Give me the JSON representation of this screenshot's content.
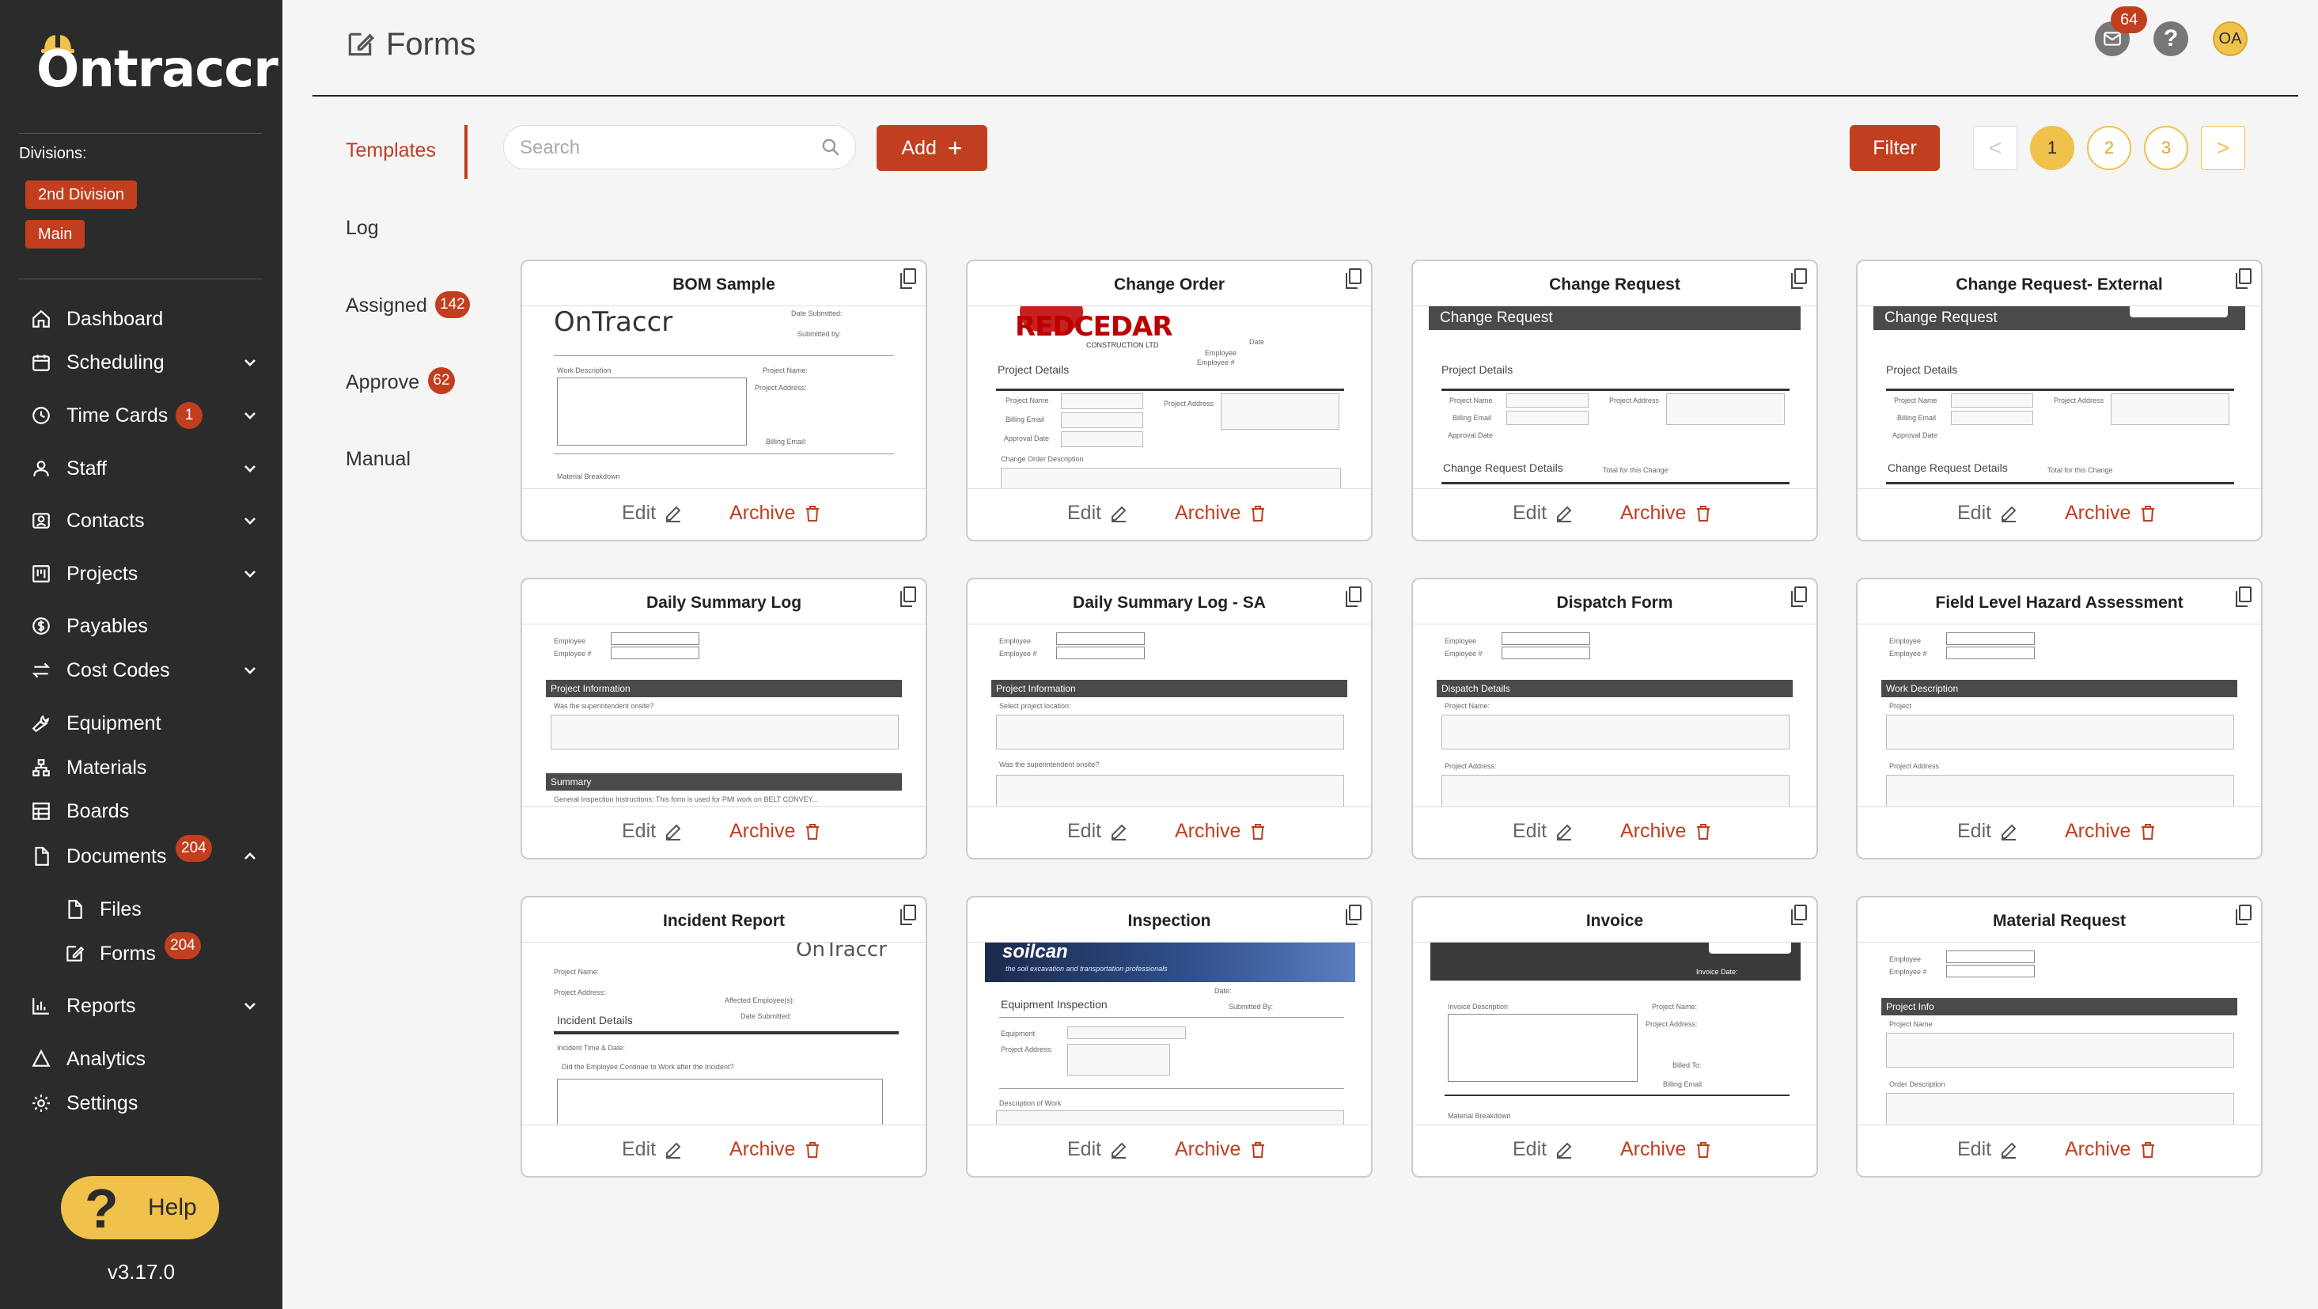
{
  "app": {
    "logo_text": "Ontraccr",
    "divisions_label": "Divisions:",
    "divisions": [
      "2nd Division",
      "Main"
    ],
    "version": "v3.17.0",
    "help_label": "Help"
  },
  "nav": {
    "dashboard": {
      "label": "Dashboard"
    },
    "scheduling": {
      "label": "Scheduling"
    },
    "time_cards": {
      "label": "Time Cards",
      "badge": "1"
    },
    "staff": {
      "label": "Staff"
    },
    "contacts": {
      "label": "Contacts"
    },
    "projects": {
      "label": "Projects"
    },
    "payables": {
      "label": "Payables"
    },
    "cost_codes": {
      "label": "Cost Codes"
    },
    "equipment": {
      "label": "Equipment"
    },
    "materials": {
      "label": "Materials"
    },
    "boards": {
      "label": "Boards"
    },
    "documents": {
      "label": "Documents",
      "badge": "204"
    },
    "files": {
      "label": "Files"
    },
    "forms": {
      "label": "Forms",
      "badge": "204"
    },
    "reports": {
      "label": "Reports"
    },
    "analytics": {
      "label": "Analytics"
    },
    "settings": {
      "label": "Settings"
    }
  },
  "header": {
    "title": "Forms",
    "mail_badge": "64",
    "help_glyph": "?",
    "avatar_initials": "OA"
  },
  "subnav": {
    "templates": "Templates",
    "log": "Log",
    "assigned": "Assigned",
    "assigned_badge": "142",
    "approve": "Approve",
    "approve_badge": "62",
    "manual": "Manual"
  },
  "toolbar": {
    "search_placeholder": "Search",
    "add_label": "Add",
    "add_glyph": "+",
    "filter_label": "Filter",
    "prev_glyph": "<",
    "next_glyph": ">",
    "pages": [
      "1",
      "2",
      "3"
    ],
    "current_page": "1"
  },
  "card_actions": {
    "edit": "Edit",
    "archive": "Archive"
  },
  "cards": [
    {
      "title": "BOM Sample"
    },
    {
      "title": "Change Order"
    },
    {
      "title": "Change Request"
    },
    {
      "title": "Change Request- External"
    },
    {
      "title": "Daily Summary Log"
    },
    {
      "title": "Daily Summary Log - SA"
    },
    {
      "title": "Dispatch Form"
    },
    {
      "title": "Field Level Hazard Assessment"
    },
    {
      "title": "Incident Report"
    },
    {
      "title": "Inspection"
    },
    {
      "title": "Invoice"
    },
    {
      "title": "Material Request"
    }
  ],
  "previews": {
    "bom": {
      "logo": "OnTraccr",
      "date_submitted": "Date Submitted:",
      "submitted_by": "Submitted by:",
      "work_description": "Work Description",
      "project_name": "Project Name:",
      "project_address": "Project Address:",
      "billing_email": "Billing Email:",
      "material_breakdown": "Material Breakdown"
    },
    "change_order": {
      "logo": "REDCEDAR",
      "logo_sub": "CONSTRUCTION LTD",
      "project_details": "Project Details",
      "project_name": "Project Name",
      "billing_email": "Billing Email",
      "approval_date": "Approval Date",
      "project_address": "Project Address",
      "description": "Change Order Description",
      "date": "Date",
      "employee": "Employee",
      "employee_num": "Employee #"
    },
    "change_request": {
      "header": "Change Request",
      "project_details": "Project Details",
      "project_name": "Project Name",
      "project_address": "Project Address",
      "billing_email": "Billing Email",
      "approval_date": "Approval Date",
      "cr_details": "Change Request Details",
      "total": "Total for this Change"
    },
    "daily_summary": {
      "employee": "Employee",
      "employee_num": "Employee #",
      "project_information": "Project Information",
      "question": "Was the superintendent onsite?",
      "summary": "Summary",
      "instructions": "General Inspection Instructions: This form is used for PMI work on BELT CONVEY..."
    },
    "daily_summary_sa": {
      "employee": "Employee",
      "employee_num": "Employee #",
      "project_information": "Project Information",
      "select": "Select project location:",
      "question": "Was the superintendent onsite?"
    },
    "dispatch": {
      "employee": "Employee",
      "employee_num": "Employee #",
      "dispatch_details": "Dispatch Details",
      "project_name": "Project Name:",
      "project_address": "Project Address:"
    },
    "hazard": {
      "employee": "Employee",
      "employee_num": "Employee #",
      "work_description": "Work Description",
      "project": "Project",
      "project_address": "Project Address"
    },
    "incident": {
      "logo": "OnTraccr",
      "project_name": "Project Name:",
      "project_address": "Project Address:",
      "affected": "Affected Employee(s):",
      "date_submitted": "Date Submitted:",
      "incident_details": "Incident Details",
      "incident_time": "Incident Time & Date:",
      "continue": "Did the Employee Continue to Work after the Incident?"
    },
    "inspection": {
      "banner": "soilcan",
      "banner_sub": "the soil excavation and transportation professionals",
      "date": "Date:",
      "equipment_inspection": "Equipment Inspection",
      "submitted_by": "Submitted By:",
      "equipment": "Equipment",
      "project_address": "Project Address:",
      "description": "Description of Work"
    },
    "invoice": {
      "invoice_date": "Invoice Date:",
      "invoice_description": "Invoice Description",
      "project_name": "Project Name:",
      "project_address": "Project Address:",
      "billed_to": "Billed To:",
      "billing_email": "Billing Email:",
      "material_breakdown": "Material Breakdown"
    },
    "material": {
      "employee": "Employee",
      "employee_num": "Employee #",
      "project_info": "Project Info",
      "project_name": "Project Name",
      "order_description": "Order Description"
    }
  },
  "colors": {
    "sidebar_bg": "#2b2b2b",
    "accent_red": "#c13e1f",
    "accent_yellow": "#f0c14b",
    "page_bg": "#f5f5f5"
  }
}
